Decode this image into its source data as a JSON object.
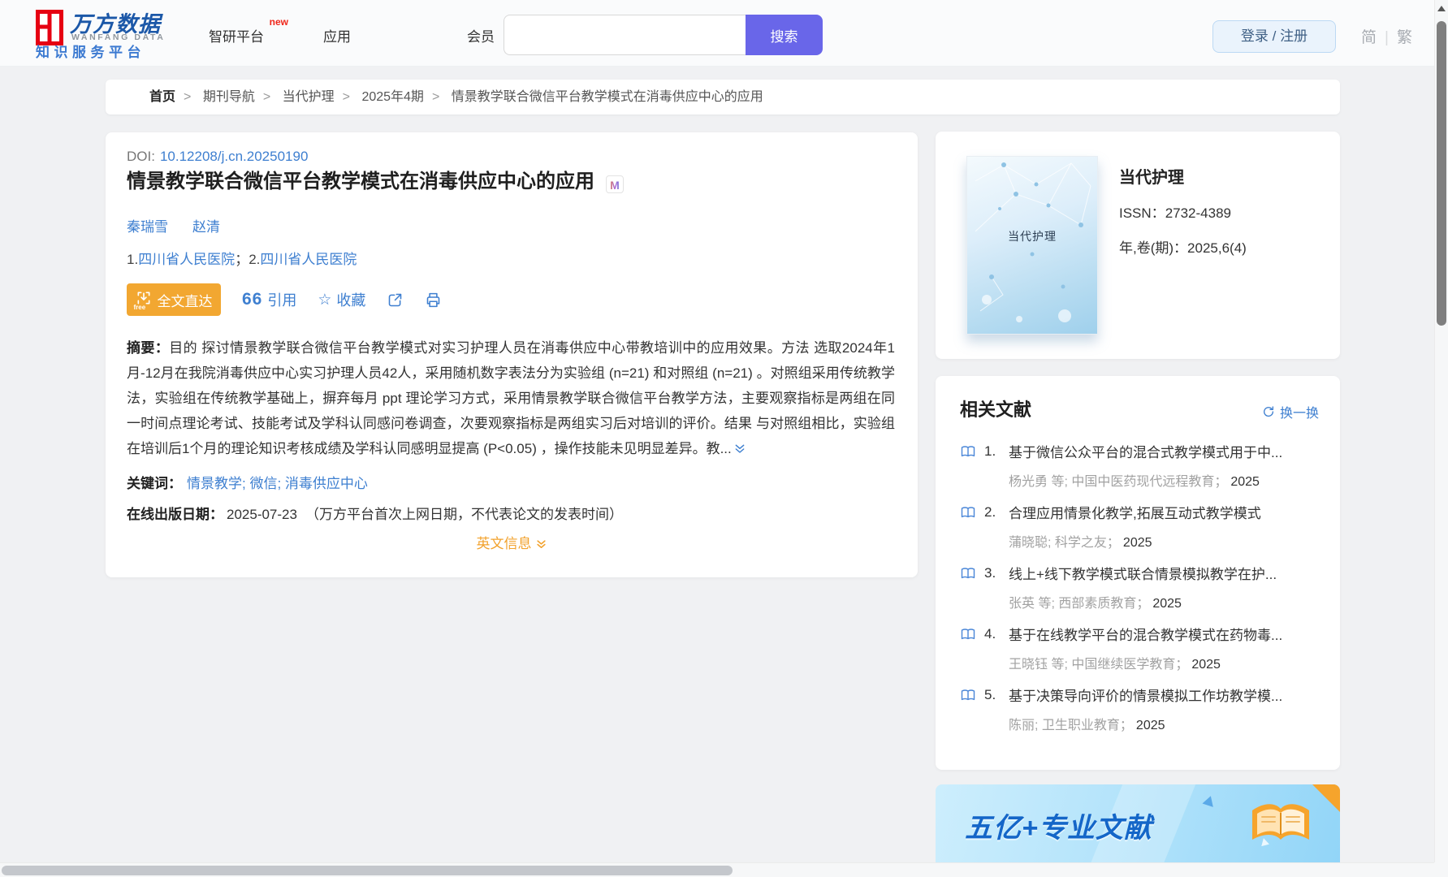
{
  "header": {
    "brand": "万方数据",
    "brand_en": "WANFANG DATA",
    "subtitle": "知识服务平台",
    "nav": [
      {
        "label": "智研平台",
        "badge": "new"
      },
      {
        "label": "应用",
        "badge": ""
      },
      {
        "label": "会员",
        "badge": ""
      }
    ],
    "search": {
      "placeholder": "",
      "value": "",
      "button": "搜索"
    },
    "login": "登录 / 注册",
    "lang": {
      "simplified": "简",
      "traditional": "繁",
      "divider": "|"
    }
  },
  "breadcrumb": {
    "items": [
      {
        "label": "首页",
        "sep": ">"
      },
      {
        "label": "期刊导航",
        "sep": ">"
      },
      {
        "label": "当代护理",
        "sep": ">"
      },
      {
        "label": "2025年4期",
        "sep": ">"
      },
      {
        "label": "情景教学联合微信平台教学模式在消毒供应中心的应用",
        "sep": ""
      }
    ]
  },
  "article": {
    "doi_label": "DOI:",
    "doi": "10.12208/j.cn.20250190",
    "title": "情景教学联合微信平台教学模式在消毒供应中心的应用",
    "badge": "M",
    "authors": [
      {
        "name": "秦瑞雪"
      },
      {
        "name": "赵清"
      }
    ],
    "affiliations": [
      {
        "num": "1.",
        "name": "四川省人民医院",
        "sep": "；"
      },
      {
        "num": "2.",
        "name": "四川省人民医院",
        "sep": ""
      }
    ],
    "actions": {
      "fulltext": "全文直达",
      "fulltext_badge": "free",
      "cite_glyph": "66",
      "cite": "引用",
      "favorite": "收藏"
    },
    "abstract_label": "摘要：",
    "abstract": "目的 探讨情景教学联合微信平台教学模式对实习护理人员在消毒供应中心带教培训中的应用效果。方法 选取2024年1月-12月在我院消毒供应中心实习护理人员42人，采用随机数字表法分为实验组 (n=21) 和对照组 (n=21) 。对照组采用传统教学法，实验组在传统教学基础上，摒弃每月 ppt 理论学习方式，采用情景教学联合微信平台教学方法，主要观察指标是两组在同一时间点理论考试、技能考试及学科认同感问卷调查，次要观察指标是两组实习后对培训的评价。结果 与对照组相比，实验组在培训后1个月的理论知识考核成绩及学科认同感明显提高 (P<0.05) ，操作技能未见明显差异。教...",
    "keywords_label": "关键词：",
    "keywords": [
      {
        "text": "情景教学",
        "sep": "; "
      },
      {
        "text": "微信",
        "sep": "; "
      },
      {
        "text": "消毒供应中心",
        "sep": ""
      }
    ],
    "pubdate_label": "在线出版日期：",
    "pubdate": "2025-07-23",
    "pubdate_note": "（万方平台首次上网日期，不代表论文的发表时间）",
    "english_info": "英文信息"
  },
  "journal": {
    "cover_title": "当代护理",
    "name": "当代护理",
    "issn_label": "ISSN：",
    "issn": "2732-4389",
    "vol_label": "年,卷(期)：",
    "vol": "2025,6(4)"
  },
  "related": {
    "title": "相关文献",
    "refresh": "换一换",
    "items": [
      {
        "num": "1.",
        "title": "基于微信公众平台的混合式教学模式用于中...",
        "meta": "杨光勇 等;  中国中医药现代远程教育",
        "sep": "；",
        "year": "2025"
      },
      {
        "num": "2.",
        "title": "合理应用情景化教学,拓展互动式教学模式",
        "meta": "蒲晓聪; 科学之友",
        "sep": "；",
        "year": "2025"
      },
      {
        "num": "3.",
        "title": "线上+线下教学模式联合情景模拟教学在护...",
        "meta": "张英 等;  西部素质教育",
        "sep": "；",
        "year": "2025"
      },
      {
        "num": "4.",
        "title": "基于在线教学平台的混合教学模式在药物毒...",
        "meta": "王晓钰 等;  中国继续医学教育",
        "sep": "；",
        "year": "2025"
      },
      {
        "num": "5.",
        "title": "基于决策导向评价的情景模拟工作坊教学模...",
        "meta": "陈丽; 卫生职业教育",
        "sep": "；",
        "year": "2025"
      }
    ]
  },
  "banner": {
    "text": "五亿+专业文献"
  },
  "colors": {
    "accent_blue": "#3e7fd0",
    "accent_orange": "#f2a731",
    "search_purple": "#6966e9",
    "logo_red": "#e60012",
    "logo_blue": "#1c58a8"
  }
}
